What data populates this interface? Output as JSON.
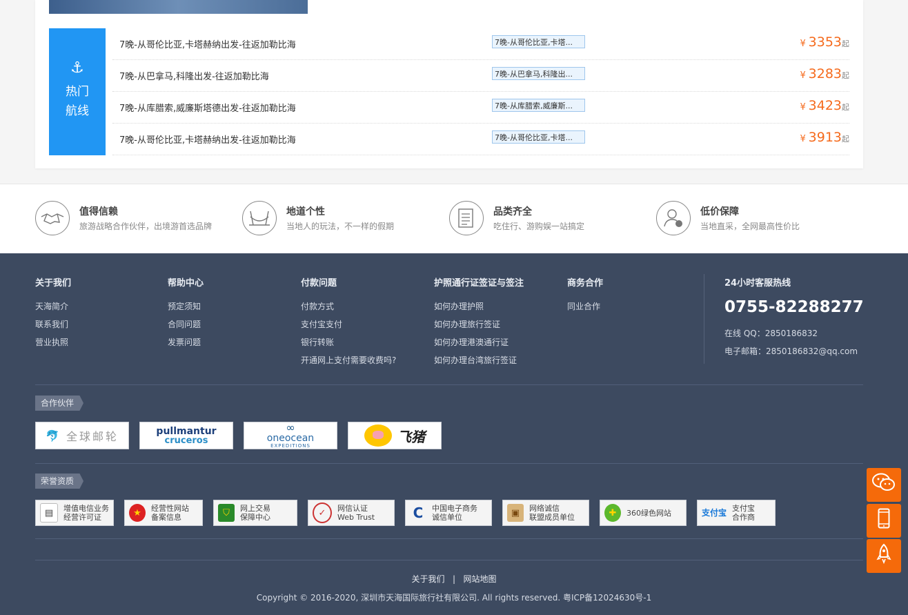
{
  "hot_routes": {
    "label_line1": "热门",
    "label_line2": "航线",
    "anchor_icon": "anchor-icon",
    "items": [
      {
        "name": "7晚-从哥伦比亚,卡塔赫纳出发-往返加勒比海",
        "tag": "7晚-从哥伦比亚,卡塔...",
        "currency": "¥",
        "price": "3353",
        "suffix": "起"
      },
      {
        "name": "7晚-从巴拿马,科隆出发-往返加勒比海",
        "tag": "7晚-从巴拿马,科隆出...",
        "currency": "¥",
        "price": "3283",
        "suffix": "起"
      },
      {
        "name": "7晚-从库腊索,威廉斯塔德出发-往返加勒比海",
        "tag": "7晚-从库腊索,威廉斯...",
        "currency": "¥",
        "price": "3423",
        "suffix": "起"
      },
      {
        "name": "7晚-从哥伦比亚,卡塔赫纳出发-往返加勒比海",
        "tag": "7晚-从哥伦比亚,卡塔...",
        "currency": "¥",
        "price": "3913",
        "suffix": "起"
      }
    ]
  },
  "features": [
    {
      "icon": "handshake-icon",
      "title": "值得信赖",
      "desc": "旅游战略合作伙伴，出境游首选品牌"
    },
    {
      "icon": "hammock-icon",
      "title": "地道个性",
      "desc": "当地人的玩法，不一样的假期"
    },
    {
      "icon": "document-list-icon",
      "title": "品类齐全",
      "desc": "吃住行、游购娱一站搞定"
    },
    {
      "icon": "person-money-icon",
      "title": "低价保障",
      "desc": "当地直采，全网最高性价比"
    }
  ],
  "footer": {
    "columns": [
      {
        "title": "关于我们",
        "links": [
          "天海简介",
          "联系我们",
          "营业执照"
        ]
      },
      {
        "title": "帮助中心",
        "links": [
          "预定须知",
          "合同问题",
          "发票问题"
        ]
      },
      {
        "title": "付款问题",
        "links": [
          "付款方式",
          "支付宝支付",
          "银行转账",
          "开通网上支付需要收费吗?"
        ]
      },
      {
        "title": "护照通行证签证与签注",
        "links": [
          "如何办理护照",
          "如何办理旅行签证",
          "如何办理港澳通行证",
          "如何办理台湾旅行签证"
        ]
      },
      {
        "title": "商务合作",
        "links": [
          "同业合作"
        ]
      }
    ],
    "hotline": {
      "title": "24小时客服热线",
      "phone": "0755-82288277",
      "qq": "在线 QQ：2850186832",
      "email": "电子邮箱：2850186832@qq.com"
    },
    "partners_label": "合作伙伴",
    "partners": [
      {
        "text": "全球邮轮"
      },
      {
        "text_top": "pullmantur",
        "text_bottom": "cruceros"
      },
      {
        "text_top": "oneocean",
        "text_bottom": "EXPEDITIONS"
      },
      {
        "text": "飞猪"
      }
    ],
    "honors_label": "荣誉资质",
    "honors": [
      {
        "line1": "增值电信业务",
        "line2": "经营许可证"
      },
      {
        "line1": "经营性网站",
        "line2": "备案信息"
      },
      {
        "line1": "网上交易",
        "line2": "保障中心"
      },
      {
        "line1": "网信认证",
        "line2": "Web Trust"
      },
      {
        "line1": "中国电子商务",
        "line2": "诚信单位"
      },
      {
        "line1": "网络诚信",
        "line2": "联盟成员单位"
      },
      {
        "line1": "360绿色网站",
        "line2": ""
      },
      {
        "line1": "支付宝",
        "line2": "合作商"
      }
    ],
    "bottom_links": [
      "关于我们",
      "网站地图"
    ],
    "bottom_sep": "|",
    "copyright": "Copyright © 2016-2020, 深圳市天海国际旅行社有限公司. All rights reserved. 粤ICP备12024630号-1"
  },
  "side_buttons": [
    {
      "icon": "wechat-icon"
    },
    {
      "icon": "mobile-icon"
    },
    {
      "icon": "rocket-icon"
    }
  ],
  "colors": {
    "accent_blue": "#2196f3",
    "price_orange": "#f56a1c",
    "footer_bg": "#3d4a60",
    "side_orange": "#f56a0a"
  }
}
